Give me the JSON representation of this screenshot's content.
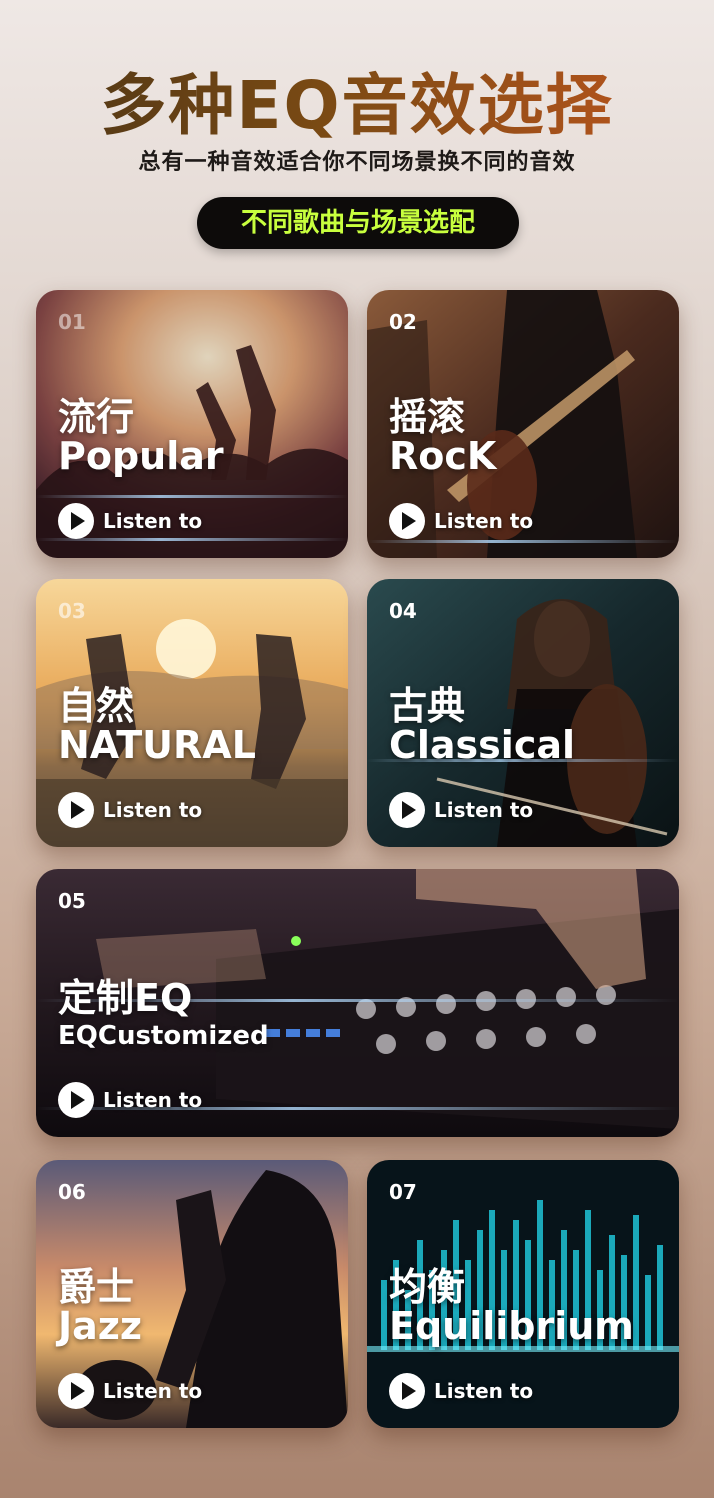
{
  "header": {
    "title": "多种EQ音效选择",
    "subtitle": "总有一种音效适合你不同场景换不同的音效",
    "pill": "不同歌曲与场景选配"
  },
  "listen_label": "Listen to",
  "cards": [
    {
      "num": "01",
      "cn": "流行",
      "en": "Popular"
    },
    {
      "num": "02",
      "cn": "摇滚",
      "en": "RocK"
    },
    {
      "num": "03",
      "cn": "自然",
      "en": "NATURAL"
    },
    {
      "num": "04",
      "cn": "古典",
      "en": "Classical"
    },
    {
      "num": "05",
      "cn": "定制EQ",
      "en": "EQCustomized"
    },
    {
      "num": "06",
      "cn": "爵士",
      "en": "Jazz"
    },
    {
      "num": "07",
      "cn": "均衡",
      "en": "Equilibrium"
    }
  ],
  "colors": {
    "pill_bg": "#0d0b0a",
    "pill_text": "#c8ff3e",
    "title_gradient_start": "#4a3416",
    "title_gradient_end": "#c0561e"
  },
  "icons": {
    "listen": "play-icon"
  }
}
